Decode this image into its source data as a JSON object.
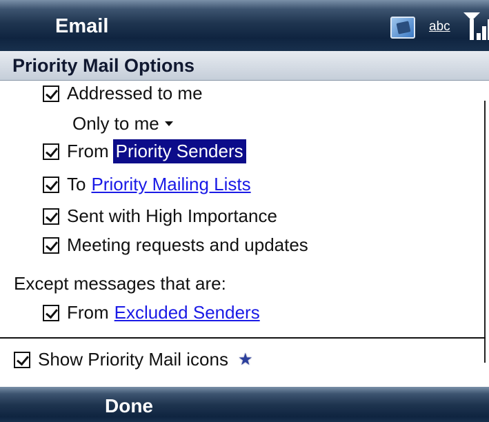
{
  "app": {
    "title": "Email",
    "input_mode": "abc",
    "icons": [
      "app-switch-icon",
      "signal-strength-icon"
    ]
  },
  "section_header": "Priority Mail Options",
  "options": {
    "addressed_to_me": {
      "label": "Addressed to me",
      "checked": true
    },
    "only_to_me_dropdown": {
      "value": "Only to me"
    },
    "from_priority_senders": {
      "prefix": "From",
      "link": "Priority Senders",
      "checked": true,
      "selected": true
    },
    "to_priority_lists": {
      "prefix": "To",
      "link": "Priority Mailing Lists",
      "checked": true
    },
    "high_importance": {
      "label": "Sent with High Importance",
      "checked": true
    },
    "meeting_requests": {
      "label": "Meeting requests and updates",
      "checked": true
    }
  },
  "except": {
    "heading": "Except messages that are:",
    "from_excluded": {
      "prefix": "From",
      "link": "Excluded Senders",
      "checked": true
    }
  },
  "show_icons": {
    "label": "Show Priority Mail icons",
    "checked": true,
    "icon": "star-icon"
  },
  "softkey": {
    "left": "Done"
  },
  "colors": {
    "titlebar": "#0f2440",
    "link": "#1a1ae6",
    "selection": "#0c0c8a"
  }
}
